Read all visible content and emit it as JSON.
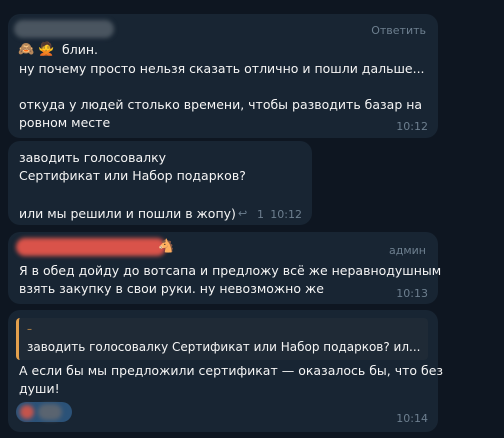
{
  "messages": [
    {
      "reply_label": "Ответить",
      "prefix_text": "блин.",
      "lines": [
        "ну почему просто нельзя сказать отлично и пошли дальше...",
        "",
        "откуда у людей столько времени, чтобы разводить базар на",
        "ровном месте"
      ],
      "time": "10:12"
    },
    {
      "lines": [
        "заводить голосовалку",
        "Сертификат или Набор подарков?",
        "",
        "или мы решили и пошли в жопу)"
      ],
      "reply_count": "1",
      "time": "10:12"
    },
    {
      "role": "админ",
      "lines": [
        "Я в обед дойду до вотсапа и предложу всё же неравнодушным",
        "взять закупку в свои руки. ну невозможно же"
      ],
      "time": "10:13"
    },
    {
      "quote_text": "заводить голосовалку  Сертификат или Набор подарков?  ил...",
      "lines": [
        "А если бы мы предложили сертификат — оказалось бы, что без",
        "души!"
      ],
      "time": "10:14"
    }
  ],
  "colors": {
    "background": "#0e1621",
    "bubble": "#182533",
    "text": "#f5f5f5",
    "meta": "#6d7f8f",
    "quote_bar": "#e3a04d",
    "reaction": "#2b5278"
  },
  "icons": [
    "monkey-emoji",
    "man-gesturing-emoji",
    "horse-emoji",
    "reply-arrow-icon"
  ]
}
